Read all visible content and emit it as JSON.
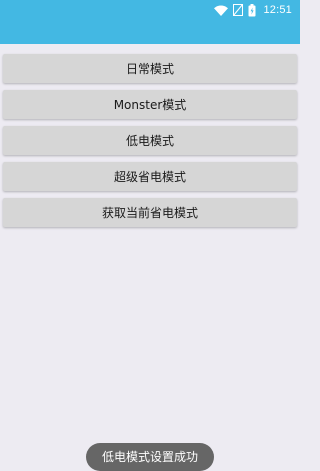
{
  "status_bar": {
    "time": "12:51",
    "icons": [
      "wifi-icon",
      "signal-icon",
      "battery-icon"
    ],
    "color": "#43b8e3"
  },
  "buttons": [
    {
      "label": "日常模式"
    },
    {
      "label": "Monster模式"
    },
    {
      "label": "低电模式"
    },
    {
      "label": "超级省电模式"
    },
    {
      "label": "获取当前省电模式"
    }
  ],
  "toast": {
    "text": "低电模式设置成功"
  }
}
